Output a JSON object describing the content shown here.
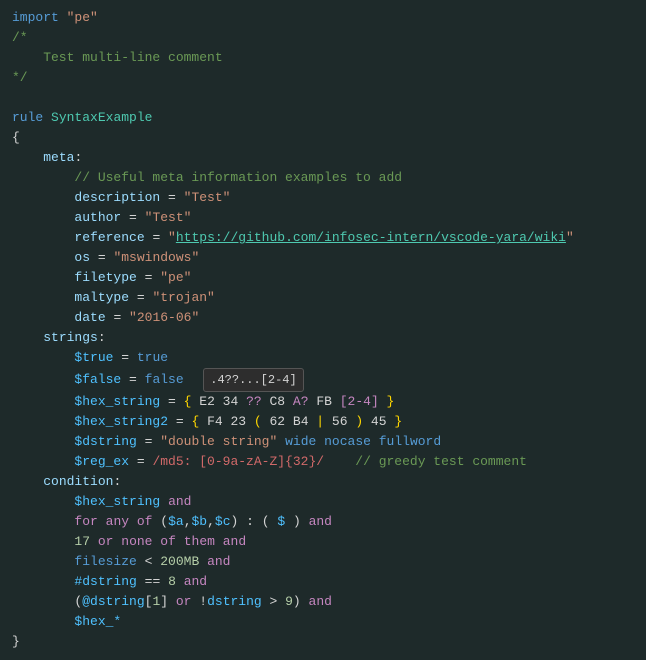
{
  "code": {
    "lines": [
      {
        "id": 1,
        "content": "import_pe"
      },
      {
        "id": 2,
        "content": "comment_open"
      },
      {
        "id": 3,
        "content": "comment_body"
      },
      {
        "id": 4,
        "content": "comment_close"
      },
      {
        "id": 5,
        "content": "blank"
      },
      {
        "id": 6,
        "content": "rule_decl"
      },
      {
        "id": 7,
        "content": "open_brace"
      },
      {
        "id": 8,
        "content": "meta_section"
      },
      {
        "id": 9,
        "content": "meta_comment"
      },
      {
        "id": 10,
        "content": "meta_description"
      },
      {
        "id": 11,
        "content": "meta_author"
      },
      {
        "id": 12,
        "content": "meta_reference"
      },
      {
        "id": 13,
        "content": "meta_os"
      },
      {
        "id": 14,
        "content": "meta_filetype"
      },
      {
        "id": 15,
        "content": "meta_maltype"
      },
      {
        "id": 16,
        "content": "meta_date"
      },
      {
        "id": 17,
        "content": "strings_section"
      },
      {
        "id": 18,
        "content": "var_true"
      },
      {
        "id": 19,
        "content": "var_false"
      },
      {
        "id": 20,
        "content": "var_hex_string"
      },
      {
        "id": 21,
        "content": "var_hex_string2"
      },
      {
        "id": 22,
        "content": "var_dstring"
      },
      {
        "id": 23,
        "content": "var_regex"
      },
      {
        "id": 24,
        "content": "condition_section"
      },
      {
        "id": 25,
        "content": "cond_hex"
      },
      {
        "id": 26,
        "content": "cond_for"
      },
      {
        "id": 27,
        "content": "cond_17"
      },
      {
        "id": 28,
        "content": "cond_filesize"
      },
      {
        "id": 29,
        "content": "cond_dstring"
      },
      {
        "id": 30,
        "content": "cond_dstring_check"
      },
      {
        "id": 31,
        "content": "cond_hex_star"
      },
      {
        "id": 32,
        "content": "close_brace"
      }
    ],
    "tooltip": ".4??...[2-4]"
  }
}
